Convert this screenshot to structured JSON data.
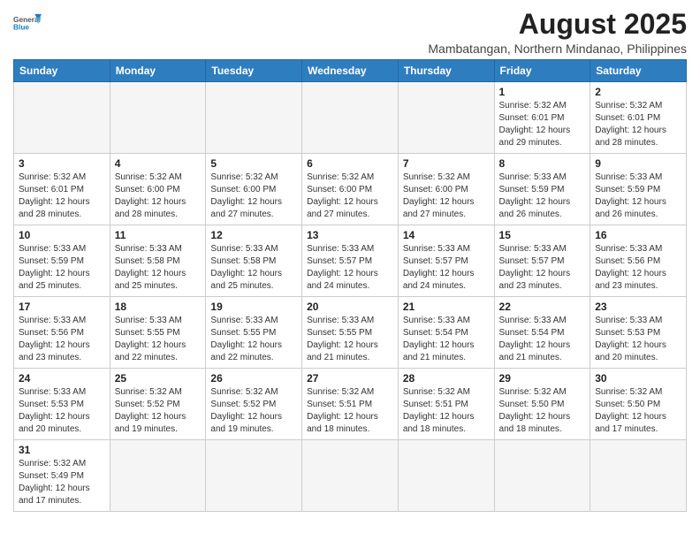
{
  "header": {
    "logo_general": "General",
    "logo_blue": "Blue",
    "month_year": "August 2025",
    "location": "Mambatangan, Northern Mindanao, Philippines"
  },
  "weekdays": [
    "Sunday",
    "Monday",
    "Tuesday",
    "Wednesday",
    "Thursday",
    "Friday",
    "Saturday"
  ],
  "weeks": [
    [
      {
        "day": "",
        "info": ""
      },
      {
        "day": "",
        "info": ""
      },
      {
        "day": "",
        "info": ""
      },
      {
        "day": "",
        "info": ""
      },
      {
        "day": "",
        "info": ""
      },
      {
        "day": "1",
        "info": "Sunrise: 5:32 AM\nSunset: 6:01 PM\nDaylight: 12 hours and 29 minutes."
      },
      {
        "day": "2",
        "info": "Sunrise: 5:32 AM\nSunset: 6:01 PM\nDaylight: 12 hours and 28 minutes."
      }
    ],
    [
      {
        "day": "3",
        "info": "Sunrise: 5:32 AM\nSunset: 6:01 PM\nDaylight: 12 hours and 28 minutes."
      },
      {
        "day": "4",
        "info": "Sunrise: 5:32 AM\nSunset: 6:00 PM\nDaylight: 12 hours and 28 minutes."
      },
      {
        "day": "5",
        "info": "Sunrise: 5:32 AM\nSunset: 6:00 PM\nDaylight: 12 hours and 27 minutes."
      },
      {
        "day": "6",
        "info": "Sunrise: 5:32 AM\nSunset: 6:00 PM\nDaylight: 12 hours and 27 minutes."
      },
      {
        "day": "7",
        "info": "Sunrise: 5:32 AM\nSunset: 6:00 PM\nDaylight: 12 hours and 27 minutes."
      },
      {
        "day": "8",
        "info": "Sunrise: 5:33 AM\nSunset: 5:59 PM\nDaylight: 12 hours and 26 minutes."
      },
      {
        "day": "9",
        "info": "Sunrise: 5:33 AM\nSunset: 5:59 PM\nDaylight: 12 hours and 26 minutes."
      }
    ],
    [
      {
        "day": "10",
        "info": "Sunrise: 5:33 AM\nSunset: 5:59 PM\nDaylight: 12 hours and 25 minutes."
      },
      {
        "day": "11",
        "info": "Sunrise: 5:33 AM\nSunset: 5:58 PM\nDaylight: 12 hours and 25 minutes."
      },
      {
        "day": "12",
        "info": "Sunrise: 5:33 AM\nSunset: 5:58 PM\nDaylight: 12 hours and 25 minutes."
      },
      {
        "day": "13",
        "info": "Sunrise: 5:33 AM\nSunset: 5:57 PM\nDaylight: 12 hours and 24 minutes."
      },
      {
        "day": "14",
        "info": "Sunrise: 5:33 AM\nSunset: 5:57 PM\nDaylight: 12 hours and 24 minutes."
      },
      {
        "day": "15",
        "info": "Sunrise: 5:33 AM\nSunset: 5:57 PM\nDaylight: 12 hours and 23 minutes."
      },
      {
        "day": "16",
        "info": "Sunrise: 5:33 AM\nSunset: 5:56 PM\nDaylight: 12 hours and 23 minutes."
      }
    ],
    [
      {
        "day": "17",
        "info": "Sunrise: 5:33 AM\nSunset: 5:56 PM\nDaylight: 12 hours and 23 minutes."
      },
      {
        "day": "18",
        "info": "Sunrise: 5:33 AM\nSunset: 5:55 PM\nDaylight: 12 hours and 22 minutes."
      },
      {
        "day": "19",
        "info": "Sunrise: 5:33 AM\nSunset: 5:55 PM\nDaylight: 12 hours and 22 minutes."
      },
      {
        "day": "20",
        "info": "Sunrise: 5:33 AM\nSunset: 5:55 PM\nDaylight: 12 hours and 21 minutes."
      },
      {
        "day": "21",
        "info": "Sunrise: 5:33 AM\nSunset: 5:54 PM\nDaylight: 12 hours and 21 minutes."
      },
      {
        "day": "22",
        "info": "Sunrise: 5:33 AM\nSunset: 5:54 PM\nDaylight: 12 hours and 21 minutes."
      },
      {
        "day": "23",
        "info": "Sunrise: 5:33 AM\nSunset: 5:53 PM\nDaylight: 12 hours and 20 minutes."
      }
    ],
    [
      {
        "day": "24",
        "info": "Sunrise: 5:33 AM\nSunset: 5:53 PM\nDaylight: 12 hours and 20 minutes."
      },
      {
        "day": "25",
        "info": "Sunrise: 5:32 AM\nSunset: 5:52 PM\nDaylight: 12 hours and 19 minutes."
      },
      {
        "day": "26",
        "info": "Sunrise: 5:32 AM\nSunset: 5:52 PM\nDaylight: 12 hours and 19 minutes."
      },
      {
        "day": "27",
        "info": "Sunrise: 5:32 AM\nSunset: 5:51 PM\nDaylight: 12 hours and 18 minutes."
      },
      {
        "day": "28",
        "info": "Sunrise: 5:32 AM\nSunset: 5:51 PM\nDaylight: 12 hours and 18 minutes."
      },
      {
        "day": "29",
        "info": "Sunrise: 5:32 AM\nSunset: 5:50 PM\nDaylight: 12 hours and 18 minutes."
      },
      {
        "day": "30",
        "info": "Sunrise: 5:32 AM\nSunset: 5:50 PM\nDaylight: 12 hours and 17 minutes."
      }
    ],
    [
      {
        "day": "31",
        "info": "Sunrise: 5:32 AM\nSunset: 5:49 PM\nDaylight: 12 hours and 17 minutes."
      },
      {
        "day": "",
        "info": ""
      },
      {
        "day": "",
        "info": ""
      },
      {
        "day": "",
        "info": ""
      },
      {
        "day": "",
        "info": ""
      },
      {
        "day": "",
        "info": ""
      },
      {
        "day": "",
        "info": ""
      }
    ]
  ]
}
